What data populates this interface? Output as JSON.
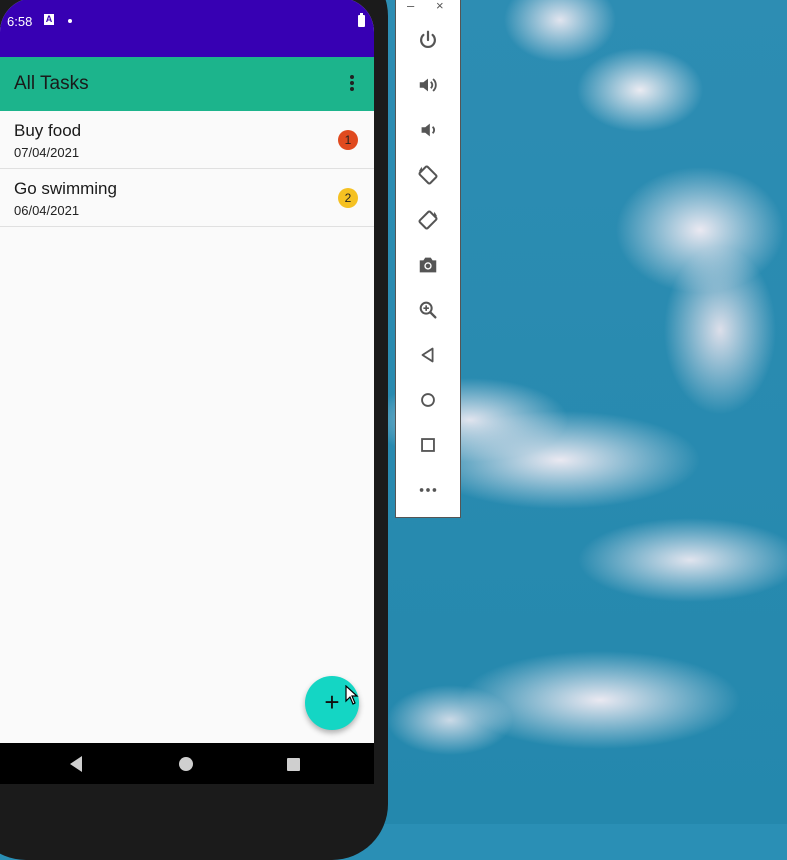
{
  "status_bar": {
    "time": "6:58",
    "a_icon": "A"
  },
  "app_bar": {
    "title": "All Tasks"
  },
  "tasks": [
    {
      "title": "Buy food",
      "date": "07/04/2021",
      "priority": "1",
      "priority_color": "#e04a1f"
    },
    {
      "title": "Go swimming",
      "date": "06/04/2021",
      "priority": "2",
      "priority_color": "#f5c122"
    }
  ],
  "fab": {
    "label": "+"
  },
  "emulator_toolbar": {
    "minimize": "–",
    "close": "×",
    "buttons": [
      "power-icon",
      "volume-up-icon",
      "volume-down-icon",
      "rotate-left-icon",
      "rotate-right-icon",
      "camera-icon",
      "zoom-icon",
      "back-icon",
      "home-icon",
      "overview-icon",
      "more-icon"
    ]
  },
  "colors": {
    "status_bar": "#3700b3",
    "app_bar": "#1cb48c",
    "fab": "#14d6c4"
  }
}
